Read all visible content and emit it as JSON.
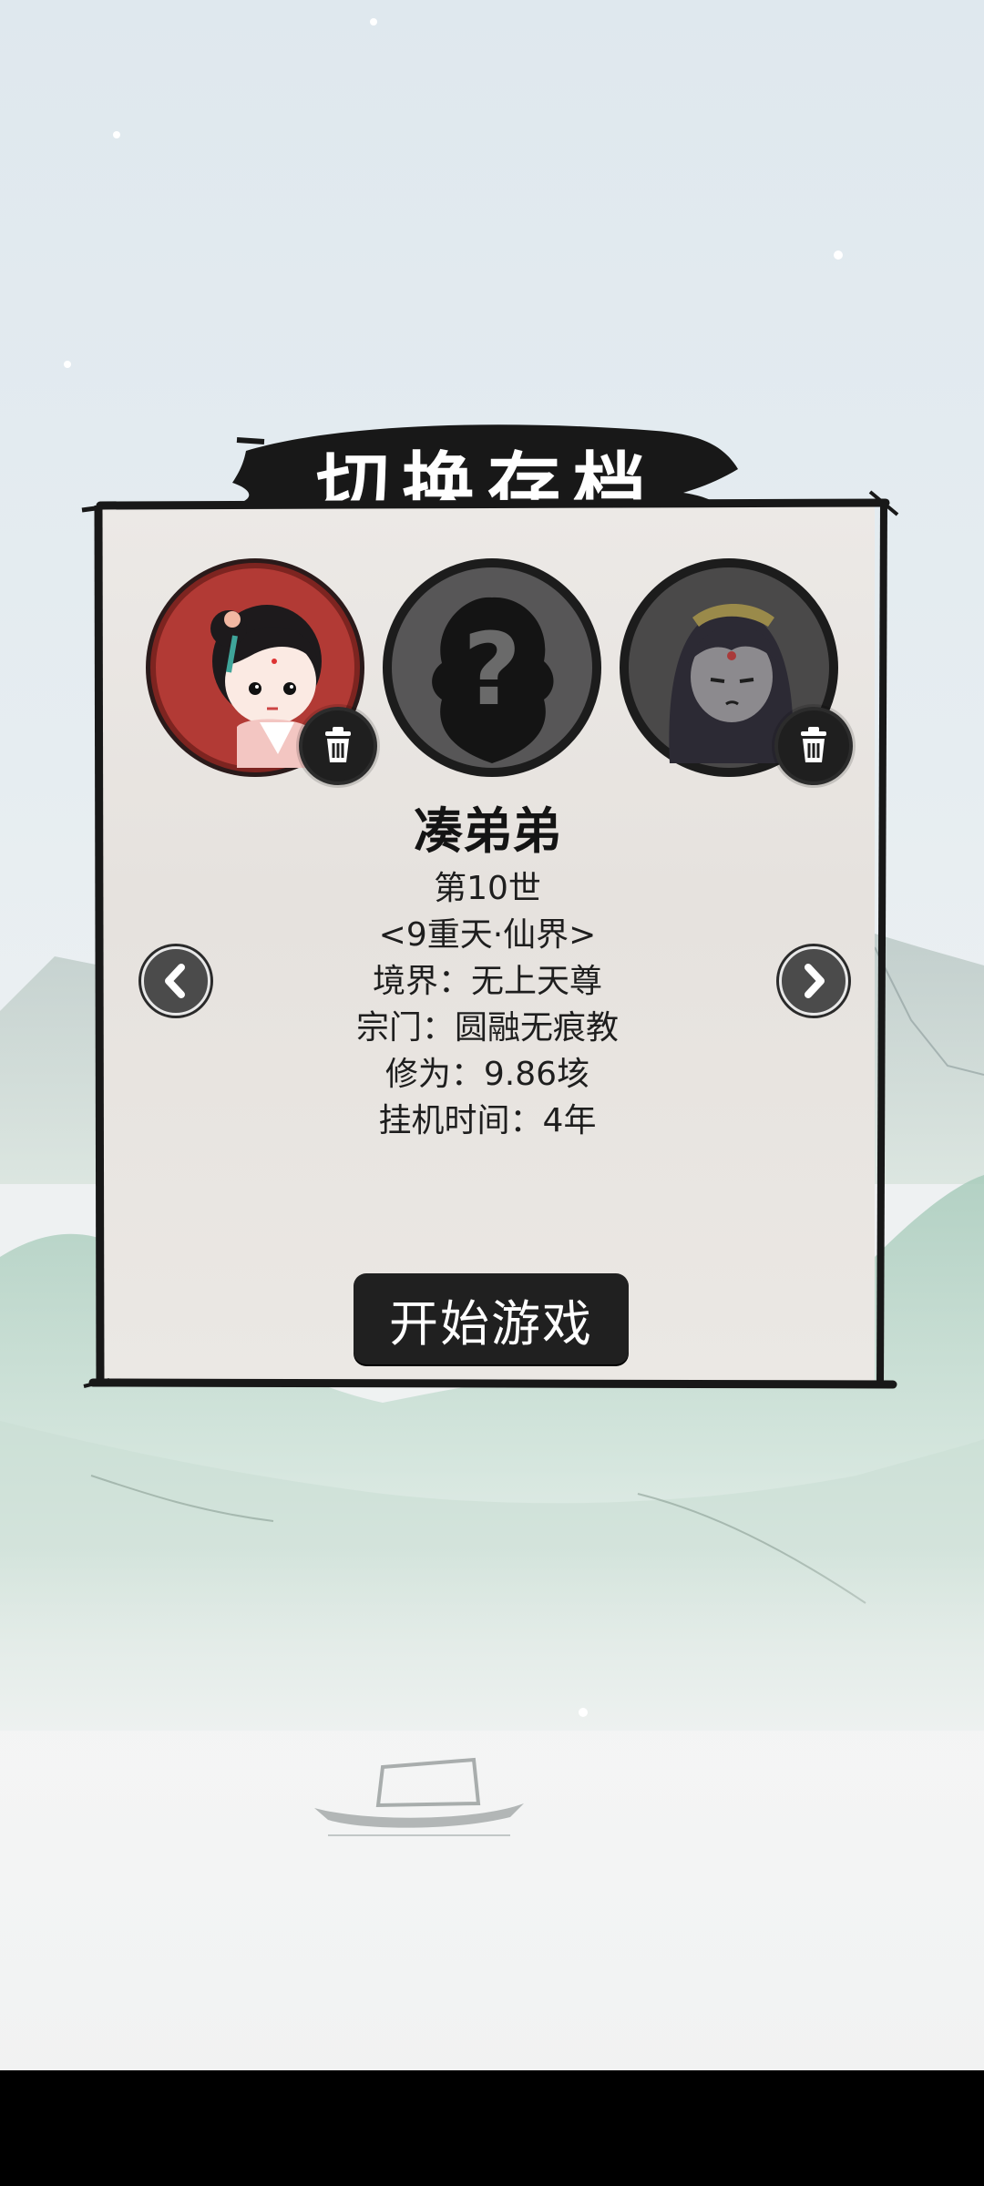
{
  "title": "切换存档",
  "slots": [
    {
      "avatar": "female-cultivator-portrait",
      "selected": true,
      "deletable": true
    },
    {
      "avatar": "unknown-silhouette-question",
      "selected": false,
      "deletable": false
    },
    {
      "avatar": "dark-haired-cultivator-portrait",
      "selected": false,
      "deletable": true
    }
  ],
  "character": {
    "name": "凑弟弟",
    "generation": "第10世",
    "realm_zone": "<9重天·仙界>",
    "realm": "境界：无上天尊",
    "sect": "宗门：圆融无痕教",
    "cultivation": "修为：9.86垓",
    "idle_time": "挂机时间：4年"
  },
  "buttons": {
    "start": "开始游戏"
  },
  "icons": {
    "prev": "chevron-left-icon",
    "next": "chevron-right-icon",
    "delete": "trash-icon"
  },
  "colors": {
    "selected_ring": "#b23a35",
    "panel_bg": "#e8e5e2",
    "button_bg": "#202020"
  }
}
